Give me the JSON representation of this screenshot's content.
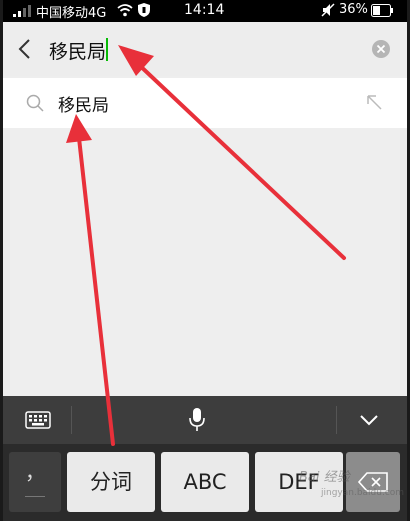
{
  "status_bar": {
    "carrier": "中国移动4G",
    "time": "14:14",
    "battery": "36%"
  },
  "search": {
    "query": "移民局"
  },
  "suggestions": [
    {
      "text": "移民局"
    }
  ],
  "keyboard": {
    "keys": [
      "，",
      "分词",
      "ABC",
      "DEF"
    ]
  },
  "watermark": {
    "text": "Bai 经验",
    "sub": "jingyan.baidu.com"
  },
  "colors": {
    "cursor": "#09bb07",
    "arrow": "#e8303a"
  },
  "icons": [
    "signal-icon",
    "wifi-icon",
    "shield-icon",
    "mute-icon",
    "battery-icon",
    "back-icon",
    "clear-icon",
    "search-icon",
    "fill-arrow-icon",
    "keyboard-icon",
    "mic-icon",
    "collapse-icon",
    "backspace-icon"
  ]
}
